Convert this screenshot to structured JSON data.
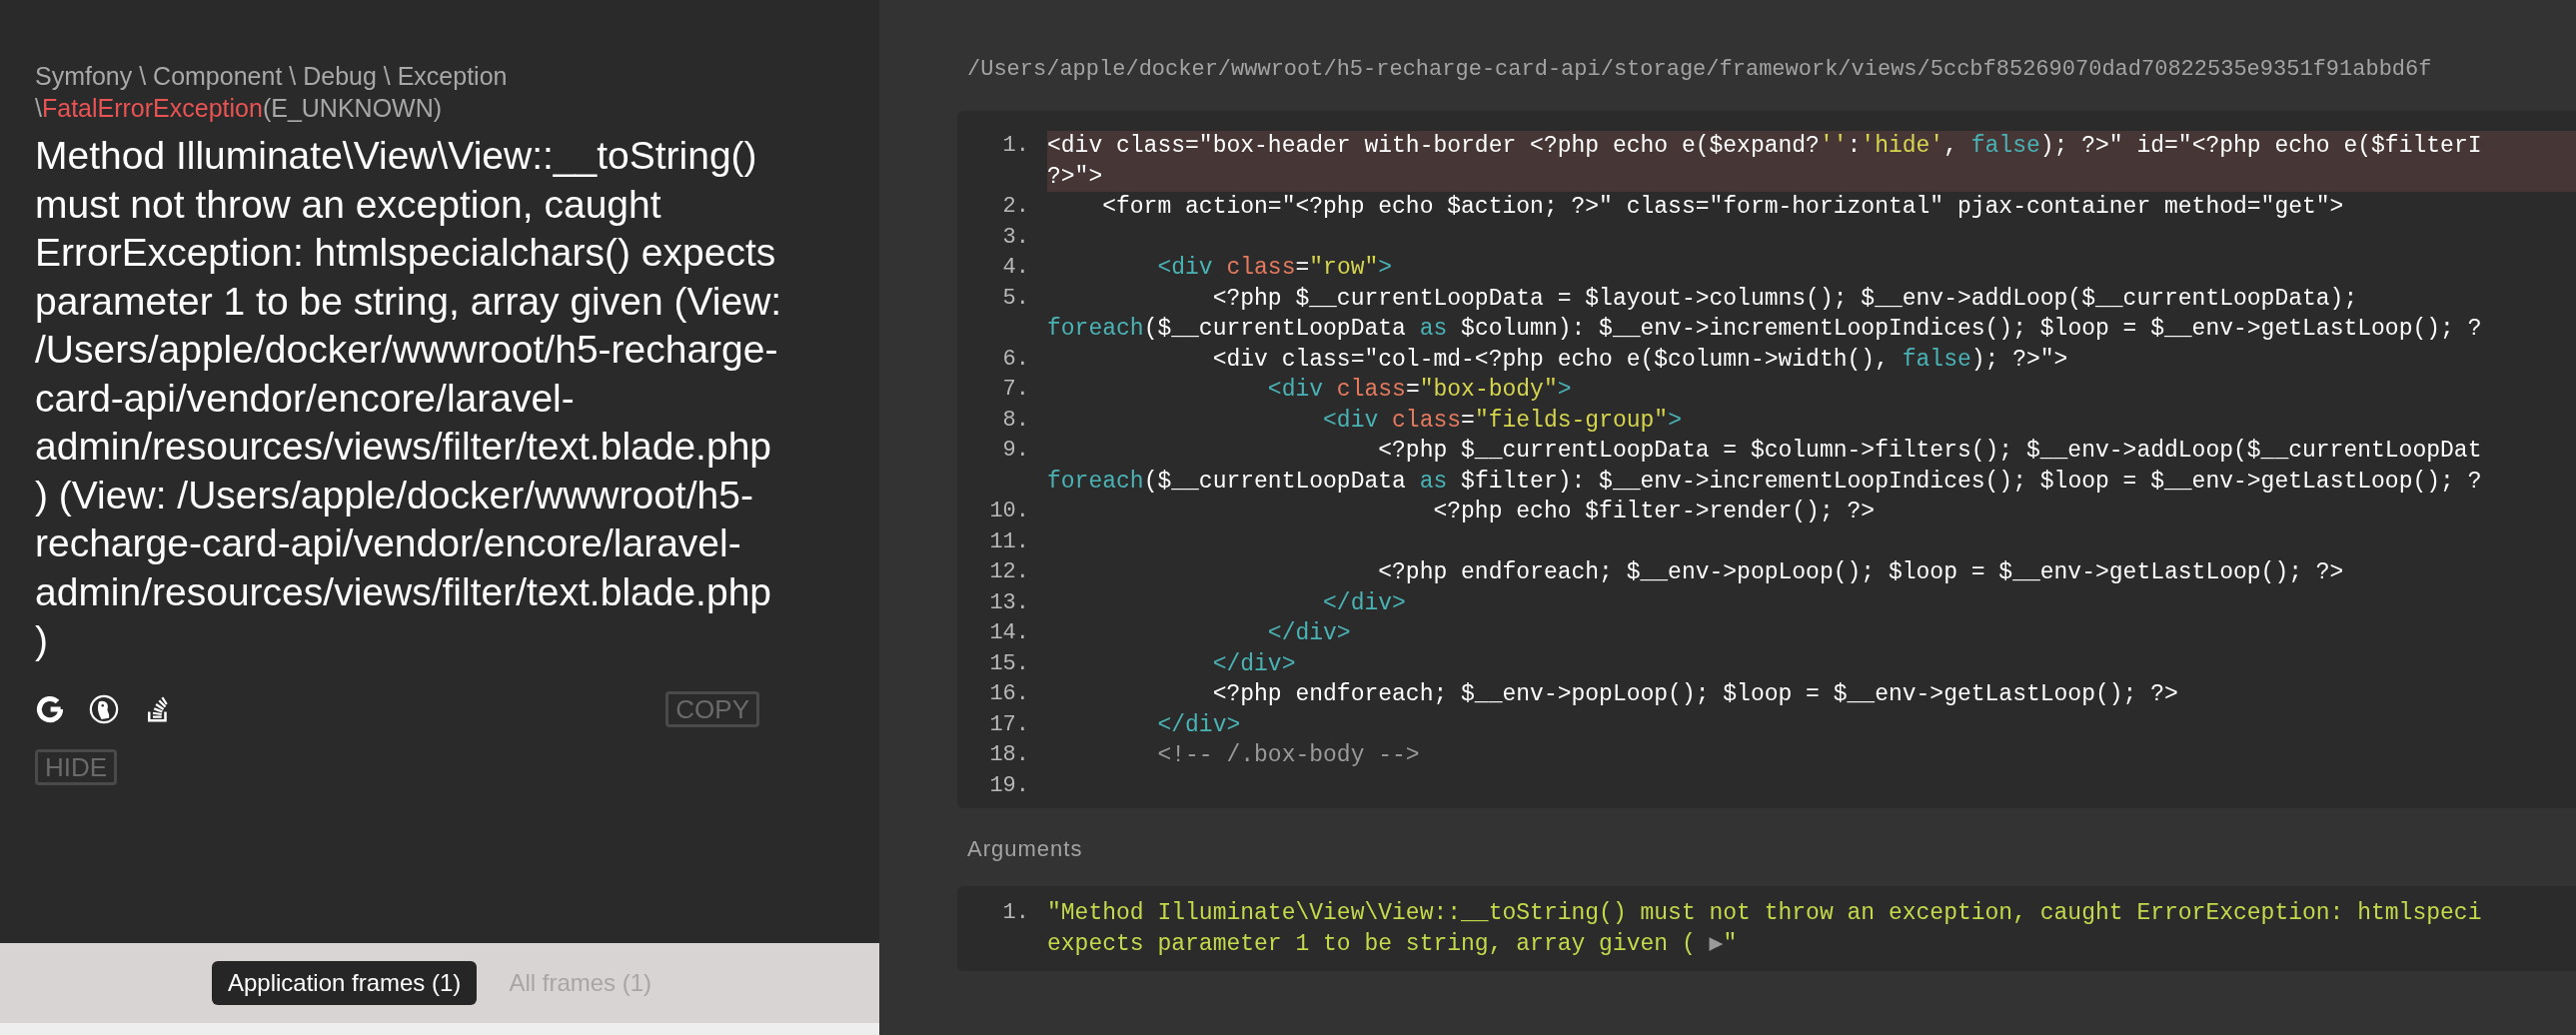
{
  "exception": {
    "namespace": "Symfony \\ Component \\ Debug \\ Exception \\",
    "class": "FatalErrorException",
    "code": "(E_UNKNOWN)"
  },
  "message": "Method Illuminate\\View\\View::__toString() must not throw an exception, caught ErrorException: htmlspecialchars() expects parameter 1 to be string, array given (View: /Users/apple/docker/wwwroot/h5-recharge-card-api/vendor/encore/laravel-admin/resources/views/filter/text.blade.php) (View: /Users/apple/docker/wwwroot/h5-recharge-card-api/vendor/encore/laravel-admin/resources/views/filter/text.blade.php)",
  "copy_button": {
    "label": "COPY"
  },
  "hide_button": {
    "label": "HIDE"
  },
  "frame_tabs": [
    {
      "label": "Application frames (1)",
      "selected": true
    },
    {
      "label": "All frames (1)",
      "selected": false
    }
  ],
  "file_path": "/Users/apple/docker/wwwroot/h5-recharge-card-api/storage/framework/views/5ccbf85269070dad70822535e9351f91abbd6f",
  "code": {
    "lines": [
      {
        "number": "1.",
        "selected": true,
        "rows": [
          {
            "tokens": [
              {
                "kind": "text",
                "text": "<div class=\"box-header with-border <?php echo e($expand?"
              },
              {
                "kind": "string",
                "text": "''"
              },
              {
                "kind": "text",
                "text": ":"
              },
              {
                "kind": "string",
                "text": "'hide'"
              },
              {
                "kind": "text",
                "text": ", "
              },
              {
                "kind": "keyword",
                "text": "false"
              },
              {
                "kind": "text",
                "text": "); ?>\" id=\"<?php echo e($filterI"
              }
            ]
          },
          {
            "tokens": [
              {
                "kind": "text",
                "text": "?>\">"
              }
            ]
          }
        ]
      },
      {
        "number": "2.",
        "selected": false,
        "rows": [
          {
            "tokens": [
              {
                "kind": "text",
                "text": "    <form action=\"<?php echo $action; ?>\" class=\"form-horizontal\" pjax-container method=\"get\">"
              }
            ]
          }
        ]
      },
      {
        "number": "3.",
        "selected": false,
        "rows": [
          {
            "tokens": []
          }
        ]
      },
      {
        "number": "4.",
        "selected": false,
        "rows": [
          {
            "tokens": [
              {
                "kind": "tag",
                "text": "        <div"
              },
              {
                "kind": "attr",
                "text": " class"
              },
              {
                "kind": "text",
                "text": "="
              },
              {
                "kind": "string",
                "text": "\"row\""
              },
              {
                "kind": "tag",
                "text": ">"
              }
            ]
          }
        ]
      },
      {
        "number": "5.",
        "selected": false,
        "rows": [
          {
            "tokens": [
              {
                "kind": "text",
                "text": "            <?php $__currentLoopData = $layout->columns(); $__env->addLoop($__currentLoopData);"
              }
            ]
          },
          {
            "tokens": [
              {
                "kind": "keyword",
                "text": "foreach"
              },
              {
                "kind": "text",
                "text": "($__currentLoopData "
              },
              {
                "kind": "keyword",
                "text": "as"
              },
              {
                "kind": "text",
                "text": " $column): $__env->incrementLoopIndices(); $loop = $__env->getLastLoop(); ?"
              }
            ]
          }
        ]
      },
      {
        "number": "6.",
        "selected": false,
        "rows": [
          {
            "tokens": [
              {
                "kind": "text",
                "text": "            <div class=\"col-md-<?php echo e($column->width(), "
              },
              {
                "kind": "keyword",
                "text": "false"
              },
              {
                "kind": "text",
                "text": "); ?>\">"
              }
            ]
          }
        ]
      },
      {
        "number": "7.",
        "selected": false,
        "rows": [
          {
            "tokens": [
              {
                "kind": "tag",
                "text": "                <div"
              },
              {
                "kind": "attr",
                "text": " class"
              },
              {
                "kind": "text",
                "text": "="
              },
              {
                "kind": "string",
                "text": "\"box-body\""
              },
              {
                "kind": "tag",
                "text": ">"
              }
            ]
          }
        ]
      },
      {
        "number": "8.",
        "selected": false,
        "rows": [
          {
            "tokens": [
              {
                "kind": "tag",
                "text": "                    <div"
              },
              {
                "kind": "attr",
                "text": " class"
              },
              {
                "kind": "text",
                "text": "="
              },
              {
                "kind": "string",
                "text": "\"fields-group\""
              },
              {
                "kind": "tag",
                "text": ">"
              }
            ]
          }
        ]
      },
      {
        "number": "9.",
        "selected": false,
        "rows": [
          {
            "tokens": [
              {
                "kind": "text",
                "text": "                        <?php $__currentLoopData = $column->filters(); $__env->addLoop($__currentLoopDat"
              }
            ]
          },
          {
            "tokens": [
              {
                "kind": "keyword",
                "text": "foreach"
              },
              {
                "kind": "text",
                "text": "($__currentLoopData "
              },
              {
                "kind": "keyword",
                "text": "as"
              },
              {
                "kind": "text",
                "text": " $filter): $__env->incrementLoopIndices(); $loop = $__env->getLastLoop(); ?"
              }
            ]
          }
        ]
      },
      {
        "number": "10.",
        "selected": false,
        "rows": [
          {
            "tokens": [
              {
                "kind": "text",
                "text": "                            <?php echo $filter->render(); ?>"
              }
            ]
          }
        ]
      },
      {
        "number": "11.",
        "selected": false,
        "rows": [
          {
            "tokens": []
          }
        ]
      },
      {
        "number": "12.",
        "selected": false,
        "rows": [
          {
            "tokens": [
              {
                "kind": "text",
                "text": "                        <?php endforeach; $__env->popLoop(); $loop = $__env->getLastLoop(); ?>"
              }
            ]
          }
        ]
      },
      {
        "number": "13.",
        "selected": false,
        "rows": [
          {
            "tokens": [
              {
                "kind": "tag",
                "text": "                    </div>"
              }
            ]
          }
        ]
      },
      {
        "number": "14.",
        "selected": false,
        "rows": [
          {
            "tokens": [
              {
                "kind": "tag",
                "text": "                </div>"
              }
            ]
          }
        ]
      },
      {
        "number": "15.",
        "selected": false,
        "rows": [
          {
            "tokens": [
              {
                "kind": "tag",
                "text": "            </div>"
              }
            ]
          }
        ]
      },
      {
        "number": "16.",
        "selected": false,
        "rows": [
          {
            "tokens": [
              {
                "kind": "text",
                "text": "            <?php endforeach; $__env->popLoop(); $loop = $__env->getLastLoop(); ?>"
              }
            ]
          }
        ]
      },
      {
        "number": "17.",
        "selected": false,
        "rows": [
          {
            "tokens": [
              {
                "kind": "tag",
                "text": "        </div>"
              }
            ]
          }
        ]
      },
      {
        "number": "18.",
        "selected": false,
        "rows": [
          {
            "tokens": [
              {
                "kind": "comment",
                "text": "        <!-- /.box-body -->"
              }
            ]
          }
        ]
      },
      {
        "number": "19.",
        "selected": false,
        "rows": [
          {
            "tokens": []
          }
        ]
      }
    ]
  },
  "arguments": {
    "title": "Arguments",
    "items": [
      {
        "number": "1.",
        "rows": [
          {
            "tokens": [
              {
                "kind": "value",
                "text": "\"Method Illuminate\\View\\View::__toString() must not throw an exception, caught ErrorException: htmlspeci"
              }
            ]
          },
          {
            "tokens": [
              {
                "kind": "value",
                "text": "expects parameter 1 to be string, array given ( "
              },
              {
                "kind": "glyph",
                "text": "▶"
              },
              {
                "kind": "value",
                "text": "\""
              }
            ]
          }
        ]
      }
    ]
  }
}
